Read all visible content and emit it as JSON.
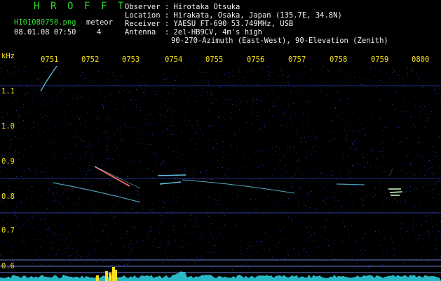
{
  "header": {
    "brand_letters": [
      "H",
      "R",
      "O",
      "F",
      "F",
      "T"
    ],
    "filename": "HI01080750.png",
    "meteor_label": "meteor",
    "meteor_count": "4",
    "datetime": "08.01.08 07:50",
    "info": [
      {
        "key": "Observer",
        "sep": " : ",
        "value": "Hirotaka Otsuka"
      },
      {
        "key": "Location",
        "sep": " : ",
        "value": "Hirakata, Osaka, Japan (135.7E, 34.8N)"
      },
      {
        "key": "Receiver",
        "sep": " : ",
        "value": "YAESU FT-690 53.749MHz, USB"
      },
      {
        "key": "Antenna ",
        "sep": " : ",
        "value": "2el-HB9CV, 4m's high"
      }
    ],
    "antenna_line2": "90-270-Azimuth (East-West), 90-Elevation (Zenith)"
  },
  "axes": {
    "y_unit": "kHz",
    "time_ticks": [
      "0751",
      "0752",
      "0753",
      "0754",
      "0755",
      "0756",
      "0757",
      "0758",
      "0759",
      "0800"
    ],
    "freq_ticks": [
      "1.1",
      "1.0",
      "0.9",
      "0.8",
      "0.7",
      "0.6"
    ]
  },
  "colors": {
    "background": "#000000",
    "noise": "#1a2a8a",
    "trace": "#6fe0ff",
    "hot": "#ff6a6a",
    "text_green": "#33dd33",
    "text_white": "#f2f2f2",
    "text_yellow": "#f7e11a",
    "activity": "#2fd8e8"
  }
}
